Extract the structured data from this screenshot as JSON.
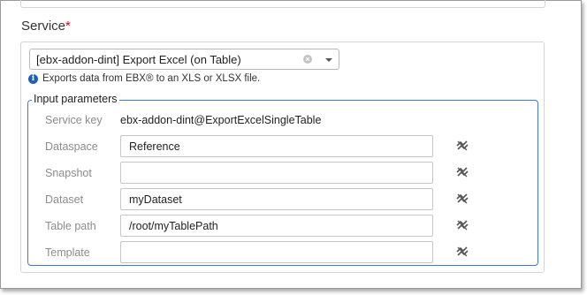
{
  "service": {
    "label": "Service",
    "required_mark": "*",
    "selected": "[ebx-addon-dint] Export Excel (on Table)",
    "clear_icon": "clear-icon",
    "caret_icon": "chevron-down-icon",
    "info": "Exports data from EBX® to an XLS or XLSX file."
  },
  "input_parameters": {
    "legend": "Input parameters",
    "service_key": {
      "label": "Service key",
      "value": "ebx-addon-dint@ExportExcelSingleTable"
    },
    "fields": [
      {
        "label": "Dataspace",
        "value": "Reference"
      },
      {
        "label": "Snapshot",
        "value": ""
      },
      {
        "label": "Dataset",
        "value": "myDataset"
      },
      {
        "label": "Table path",
        "value": "/root/myTablePath"
      },
      {
        "label": "Template",
        "value": ""
      }
    ],
    "row_icon": "inherit-link-icon"
  },
  "colors": {
    "required": "#d0021b",
    "fieldset_border": "#3a7bd5",
    "info_icon": "#1f5fb5",
    "label_gray": "#8c8c8c"
  }
}
